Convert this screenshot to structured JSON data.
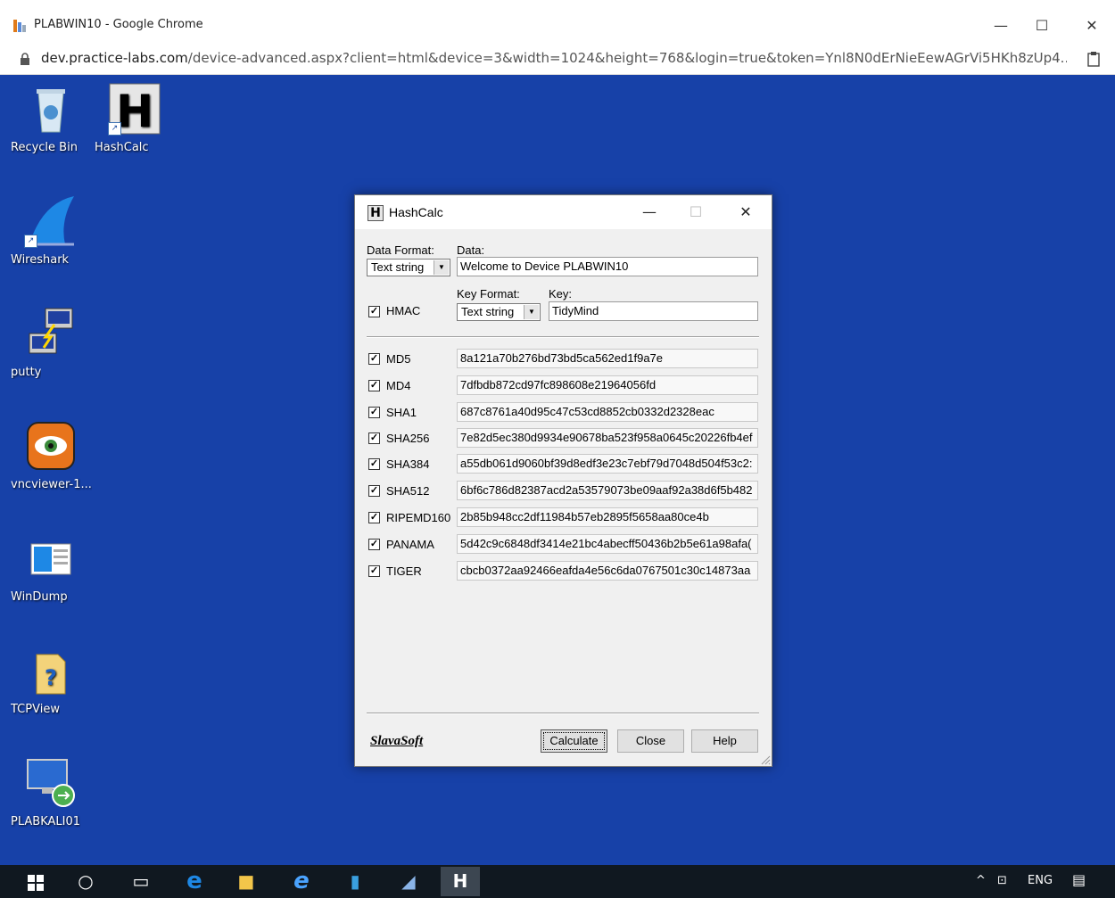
{
  "browser": {
    "window_title": "PLABWIN10 - Google Chrome",
    "url_host": "dev.practice-labs.com",
    "url_path": "/device-advanced.aspx?client=html&device=3&width=1024&height=768&login=true&token=Ynl8N0dErNieEewAGrVi5HKh8zUp4...",
    "minimize": "—",
    "maximize": "☐",
    "close": "✕"
  },
  "desktop": {
    "background": "#1741a8",
    "icons": [
      {
        "label": "Recycle Bin",
        "icon": "recycle-bin-icon"
      },
      {
        "label": "HashCalc",
        "icon": "hashcalc-icon"
      },
      {
        "label": "Wireshark",
        "icon": "wireshark-icon"
      },
      {
        "label": "putty",
        "icon": "putty-icon"
      },
      {
        "label": "vncviewer-1...",
        "icon": "vncviewer-icon"
      },
      {
        "label": "WinDump",
        "icon": "windump-icon"
      },
      {
        "label": "TCPView",
        "icon": "tcpview-icon"
      },
      {
        "label": "PLABKALI01",
        "icon": "remote-desktop-icon"
      }
    ]
  },
  "hashcalc": {
    "title": "HashCalc",
    "title_icon": "H",
    "data_format_label": "Data Format:",
    "data_format_value": "Text string",
    "data_label": "Data:",
    "data_value": "Welcome to Device PLABWIN10",
    "hmac_label": "HMAC",
    "key_format_label": "Key Format:",
    "key_format_value": "Text string",
    "key_label": "Key:",
    "key_value": "TidyMind",
    "rows": [
      {
        "label": "MD5",
        "value": "8a121a70b276bd73bd5ca562ed1f9a7e"
      },
      {
        "label": "MD4",
        "value": "7dfbdb872cd97fc898608e21964056fd"
      },
      {
        "label": "SHA1",
        "value": "687c8761a40d95c47c53cd8852cb0332d2328eac"
      },
      {
        "label": "SHA256",
        "value": "7e82d5ec380d9934e90678ba523f958a0645c20226fb4ef"
      },
      {
        "label": "SHA384",
        "value": "a55db061d9060bf39d8edf3e23c7ebf79d7048d504f53c2:"
      },
      {
        "label": "SHA512",
        "value": "6bf6c786d82387acd2a53579073be09aaf92a38d6f5b482"
      },
      {
        "label": "RIPEMD160",
        "value": "2b85b948cc2df11984b57eb2895f5658aa80ce4b"
      },
      {
        "label": "PANAMA",
        "value": "5d42c9c6848df3414e21bc4abecff50436b2b5e61a98afa("
      },
      {
        "label": "TIGER",
        "value": "cbcb0372aa92466eafda4e56c6da0767501c30c14873aa"
      }
    ],
    "brand": "SlavaSoft",
    "calculate_button": "Calculate",
    "close_button": "Close",
    "help_button": "Help"
  },
  "taskbar": {
    "background": "#101820",
    "tray_language": "ENG",
    "tray_chevron": "^"
  }
}
